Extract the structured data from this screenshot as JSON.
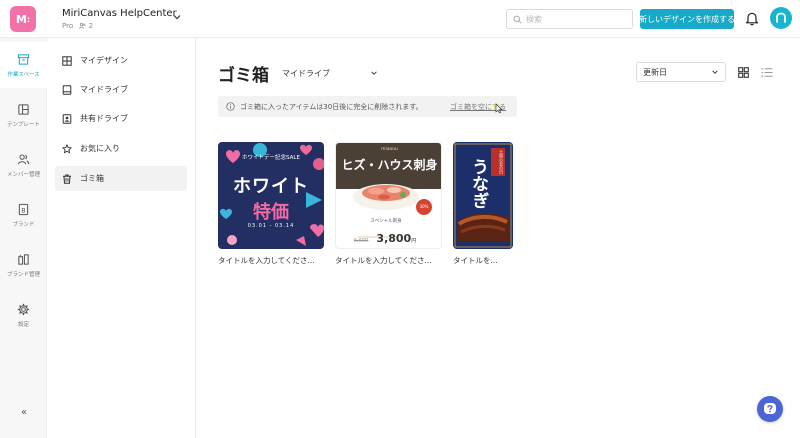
{
  "header": {
    "logo_text": "M",
    "workspace_name": "MiriCanvas HelpCenter",
    "plan": "Pro",
    "member_count": "2",
    "search_placeholder": "検索",
    "create_button": "新しいデザインを作成する"
  },
  "rail": {
    "items": [
      {
        "label": "作業スペース",
        "icon": "archive-icon",
        "active": true
      },
      {
        "label": "テンプレート",
        "icon": "template-layout-icon",
        "active": false
      },
      {
        "label": "メンバー管理",
        "icon": "members-icon",
        "active": false
      },
      {
        "label": "ブランド",
        "icon": "brand-b-icon",
        "active": false
      },
      {
        "label": "ブランド管理",
        "icon": "brand-manage-icon",
        "active": false
      },
      {
        "label": "設定",
        "icon": "gear-icon",
        "active": false
      }
    ],
    "collapse_label": "«"
  },
  "sidebar": {
    "items": [
      {
        "label": "マイデザイン",
        "icon": "my-design-icon"
      },
      {
        "label": "マイドライブ",
        "icon": "my-drive-icon"
      },
      {
        "label": "共有ドライブ",
        "icon": "shared-drive-icon"
      },
      {
        "label": "お気に入り",
        "icon": "star-icon"
      },
      {
        "label": "ゴミ箱",
        "icon": "trash-icon",
        "active": true
      }
    ]
  },
  "main": {
    "title": "ゴミ箱",
    "drive_filter": "マイドライブ",
    "sort": "更新日",
    "notice": "ゴミ箱に入ったアイテムは30日後に完全に削除されます。",
    "empty_trash_link": "ゴミ箱を空にする",
    "cards": [
      {
        "title": "タイトルを入力してくださ...",
        "thumb_subtitle": "ホワイトデー記念SALE",
        "thumb_headline": "ホワイト",
        "thumb_highlight": "特価",
        "thumb_dates": "03.01 - 03.14"
      },
      {
        "title": "タイトルを入力してくださ...",
        "thumb_brand": "miaonu",
        "thumb_headline": "ヒズ・ハウス刺身",
        "thumb_caption": "スペシャル刺身",
        "thumb_old_price": "5,600",
        "thumb_price": "3,800",
        "thumb_price_unit": "円",
        "thumb_badge": "30%"
      },
      {
        "title": "タイトルを...",
        "thumb_tag": "土用の丑の日",
        "thumb_headline": "うなぎ"
      }
    ]
  },
  "colors": {
    "accent": "#17a9c7",
    "logo": "#f272a8",
    "help": "#4b66d4"
  }
}
